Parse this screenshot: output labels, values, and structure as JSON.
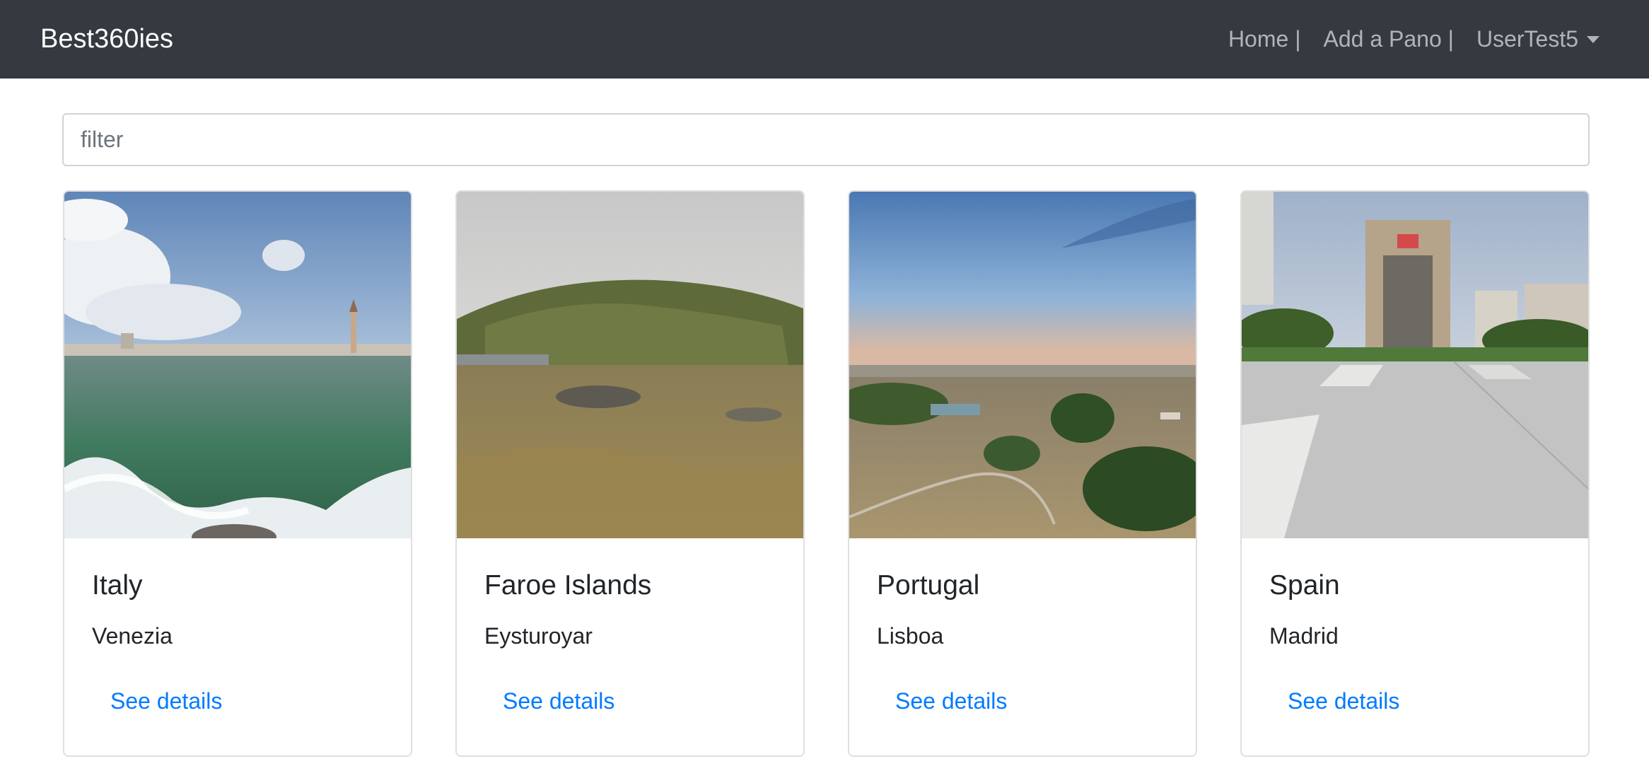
{
  "navbar": {
    "brand": "Best360ies",
    "links": [
      {
        "label": "Home |"
      },
      {
        "label": "Add a Pano |"
      }
    ],
    "user": {
      "label": "UserTest5",
      "icon": "caret-down-icon"
    }
  },
  "filter": {
    "placeholder": "filter",
    "value": ""
  },
  "cards": [
    {
      "title": "Italy",
      "subtitle": "Venezia",
      "link": "See details"
    },
    {
      "title": "Faroe Islands",
      "subtitle": "Eysturoyar",
      "link": "See details"
    },
    {
      "title": "Portugal",
      "subtitle": "Lisboa",
      "link": "See details"
    },
    {
      "title": "Spain",
      "subtitle": "Madrid",
      "link": "See details"
    }
  ],
  "colors": {
    "navbar_bg": "#343a40",
    "link": "#007bff",
    "border": "#dfdfdf"
  }
}
